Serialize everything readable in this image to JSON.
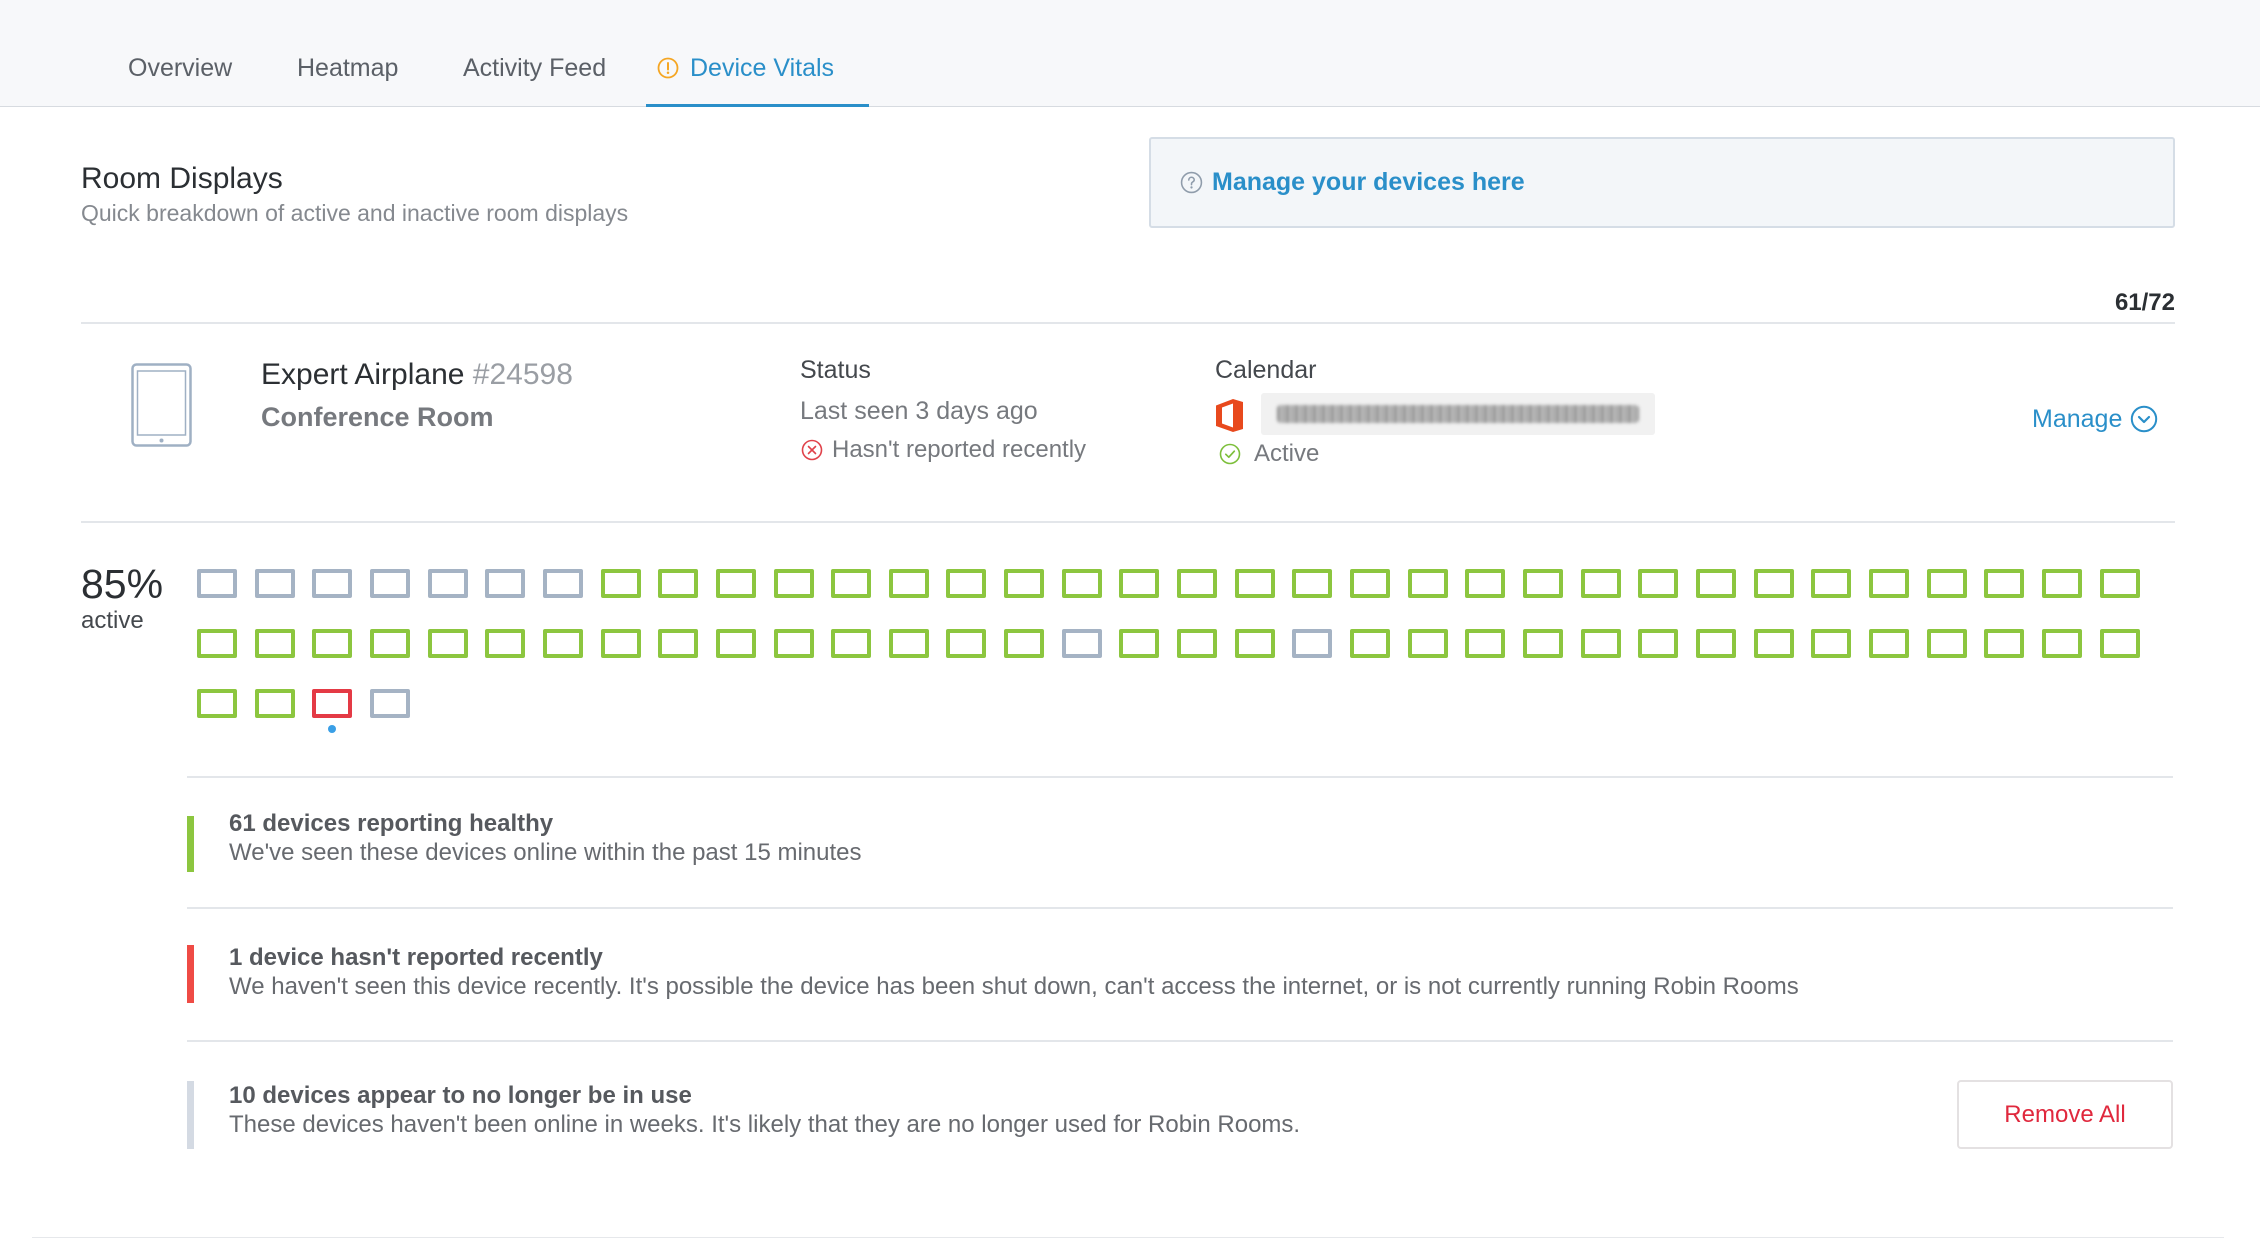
{
  "tabs": [
    {
      "label": "Overview",
      "active": false
    },
    {
      "label": "Heatmap",
      "active": false
    },
    {
      "label": "Activity Feed",
      "active": false
    },
    {
      "label": "Device Vitals",
      "active": true,
      "icon": "warning-circle-icon"
    }
  ],
  "section": {
    "title": "Room Displays",
    "subtitle": "Quick breakdown of active and inactive room displays"
  },
  "manage_banner": {
    "icon": "help-circle-icon",
    "label": "Manage your devices here"
  },
  "count": "61/72",
  "device": {
    "icon": "tablet-icon",
    "name": "Expert Airplane",
    "id": "#24598",
    "room_type": "Conference Room",
    "status": {
      "heading": "Status",
      "last_seen": "Last seen 3 days ago",
      "state": "Hasn't reported recently",
      "state_icon": "x-circle-icon"
    },
    "calendar": {
      "heading": "Calendar",
      "provider_icon": "office-icon",
      "state": "Active",
      "state_icon": "check-circle-icon"
    },
    "manage": {
      "label": "Manage",
      "icon": "chevron-down-circle-icon"
    }
  },
  "summary": {
    "percent": "85%",
    "label": "active"
  },
  "colors": {
    "accent": "#2a8fc9",
    "healthy": "#8cc63f",
    "not_reported": "#e43a45",
    "unused": "#a5b3c4",
    "legend_healthy": "#8cc63f",
    "legend_not_reported": "#ef4b45",
    "legend_unused": "#d4dae3",
    "warning": "#f5a623",
    "selected": "#3a9fe6"
  },
  "devices": [
    "unused",
    "unused",
    "unused",
    "unused",
    "unused",
    "unused",
    "unused",
    "healthy",
    "healthy",
    "healthy",
    "healthy",
    "healthy",
    "healthy",
    "healthy",
    "healthy",
    "healthy",
    "healthy",
    "healthy",
    "healthy",
    "healthy",
    "healthy",
    "healthy",
    "healthy",
    "healthy",
    "healthy",
    "healthy",
    "healthy",
    "healthy",
    "healthy",
    "healthy",
    "healthy",
    "healthy",
    "healthy",
    "healthy",
    "healthy",
    "healthy",
    "healthy",
    "healthy",
    "healthy",
    "healthy",
    "healthy",
    "healthy",
    "healthy",
    "healthy",
    "healthy",
    "healthy",
    "healthy",
    "healthy",
    "healthy",
    "unused",
    "healthy",
    "healthy",
    "healthy",
    "unused",
    "healthy",
    "healthy",
    "healthy",
    "healthy",
    "healthy",
    "healthy",
    "healthy",
    "healthy",
    "healthy",
    "healthy",
    "healthy",
    "healthy",
    "healthy",
    "healthy",
    "healthy",
    "healthy",
    "not_reported",
    "unused"
  ],
  "selected_device_index": 70,
  "legend": [
    {
      "status": "healthy",
      "title": "61 devices reporting healthy",
      "description": "We've seen these devices online within the past 15 minutes"
    },
    {
      "status": "not_reported",
      "title": "1 device hasn't reported recently",
      "description": "We haven't seen this device recently. It's possible the device has been shut down, can't access the internet, or is not currently running Robin Rooms"
    },
    {
      "status": "unused",
      "title": "10 devices appear to no longer be in use",
      "description": "These devices haven't been online in weeks. It's likely that they are no longer used for Robin Rooms.",
      "action": "Remove All"
    }
  ]
}
